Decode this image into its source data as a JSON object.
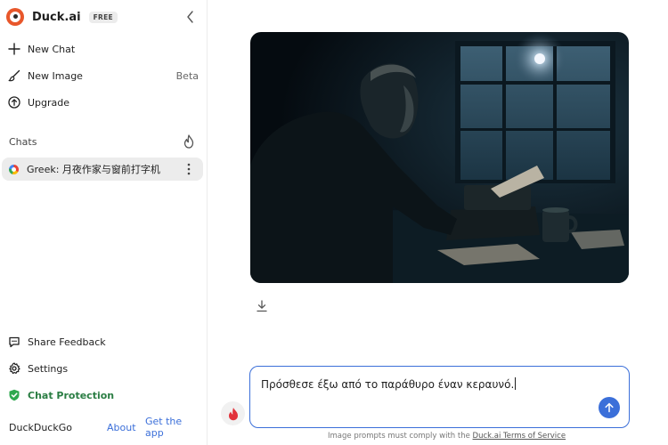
{
  "sidebar": {
    "brand": {
      "name": "Duck.ai",
      "badge": "FREE"
    },
    "nav": [
      {
        "label": "New Chat",
        "icon": "plus-icon"
      },
      {
        "label": "New Image",
        "icon": "brush-icon",
        "extra": "Beta"
      },
      {
        "label": "Upgrade",
        "icon": "arrow-up-circle-icon"
      }
    ],
    "chats_title": "Chats",
    "chats": [
      {
        "title": "Greek: 月夜作家与窗前打字机"
      }
    ],
    "bottom": [
      {
        "label": "Share Feedback",
        "icon": "feedback-icon"
      },
      {
        "label": "Settings",
        "icon": "gear-icon"
      },
      {
        "label": "Chat Protection",
        "icon": "shield-check-icon"
      }
    ],
    "footer": {
      "brand": "DuckDuckGo",
      "about": "About",
      "get_app": "Get the app"
    }
  },
  "composer": {
    "value": "Πρόσθεσε έξω από το παράθυρο έναν κεραυνό."
  },
  "terms": {
    "prefix": "Image prompts must comply with the ",
    "link": "Duck.ai Terms of Service"
  },
  "colors": {
    "accent": "#3b6fd9",
    "brand": "#e8572b",
    "protection": "#2fa84f",
    "fire": "#e2323b"
  }
}
